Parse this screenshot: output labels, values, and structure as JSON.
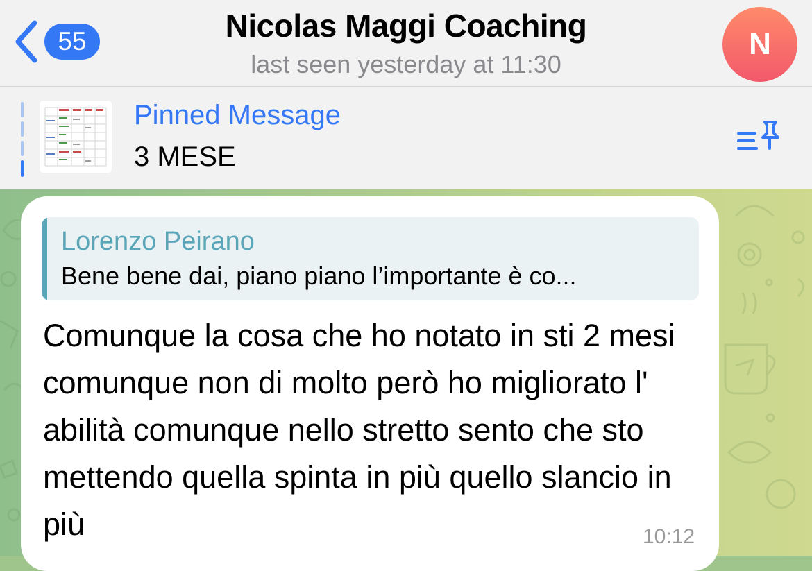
{
  "header": {
    "back_count": "55",
    "title": "Nicolas Maggi Coaching",
    "status": "last seen yesterday at 11:30",
    "avatar_initial": "N"
  },
  "pinned": {
    "label": "Pinned Message",
    "text": "3 MESE",
    "list_icon": "pinned-list-icon"
  },
  "message": {
    "reply_author": "Lorenzo Peirano",
    "reply_text": "Bene bene dai, piano piano l’importante è co...",
    "text": "Comunque la cosa che ho notato in sti 2 mesi comunque non di molto però ho migliorato l' abilità comunque nello stretto sento che sto mettendo quella spinta in più quello slancio in più",
    "time": "10:12"
  },
  "colors": {
    "accent": "#3478f6",
    "reply_accent": "#5aa6b8",
    "avatar_top": "#ff8a6a",
    "avatar_bottom": "#f2596b"
  }
}
